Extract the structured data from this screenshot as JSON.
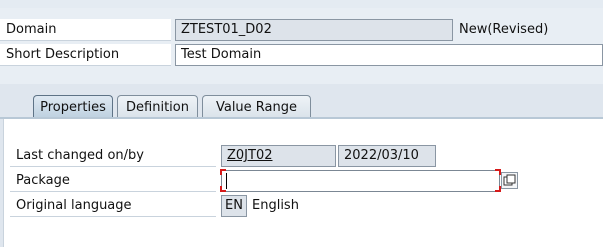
{
  "header": {
    "domain_label": "Domain",
    "domain_value": "ZTEST01_D02",
    "status": "New(Revised)",
    "short_desc_label": "Short Description",
    "short_desc_value": "Test Domain"
  },
  "tabs": [
    {
      "label": "Properties",
      "active": true
    },
    {
      "label": "Definition",
      "active": false
    },
    {
      "label": "Value Range",
      "active": false
    }
  ],
  "properties": {
    "last_changed_label": "Last changed on/by",
    "last_changed_user": "Z0JT02",
    "last_changed_date": "2022/03/10",
    "package_label": "Package",
    "package_value": "",
    "orig_lang_label": "Original language",
    "orig_lang_code": "EN",
    "orig_lang_name": "English"
  },
  "icons": {
    "value_help": "value-help-icon"
  }
}
